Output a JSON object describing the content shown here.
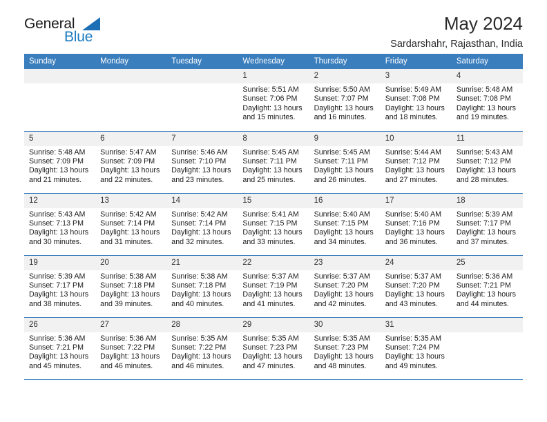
{
  "brand": {
    "word_one": "General",
    "word_two": "Blue",
    "triangle_icon": "triangle-icon",
    "colors": {
      "blue": "#1c7ac0",
      "dark": "#1a1a1a"
    }
  },
  "header": {
    "title": "May 2024",
    "subtitle": "Sardarshahr, Rajasthan, India"
  },
  "theme": {
    "header_bg": "#3a7ebe",
    "daynum_bg": "#f1f1f1",
    "row_rule": "#3a7ebe"
  },
  "weekdays": [
    "Sunday",
    "Monday",
    "Tuesday",
    "Wednesday",
    "Thursday",
    "Friday",
    "Saturday"
  ],
  "weeks": [
    [
      {
        "day": "",
        "sunrise": "",
        "sunset": "",
        "daylight_1": "",
        "daylight_2": ""
      },
      {
        "day": "",
        "sunrise": "",
        "sunset": "",
        "daylight_1": "",
        "daylight_2": ""
      },
      {
        "day": "",
        "sunrise": "",
        "sunset": "",
        "daylight_1": "",
        "daylight_2": ""
      },
      {
        "day": "1",
        "sunrise": "Sunrise: 5:51 AM",
        "sunset": "Sunset: 7:06 PM",
        "daylight_1": "Daylight: 13 hours",
        "daylight_2": "and 15 minutes."
      },
      {
        "day": "2",
        "sunrise": "Sunrise: 5:50 AM",
        "sunset": "Sunset: 7:07 PM",
        "daylight_1": "Daylight: 13 hours",
        "daylight_2": "and 16 minutes."
      },
      {
        "day": "3",
        "sunrise": "Sunrise: 5:49 AM",
        "sunset": "Sunset: 7:08 PM",
        "daylight_1": "Daylight: 13 hours",
        "daylight_2": "and 18 minutes."
      },
      {
        "day": "4",
        "sunrise": "Sunrise: 5:48 AM",
        "sunset": "Sunset: 7:08 PM",
        "daylight_1": "Daylight: 13 hours",
        "daylight_2": "and 19 minutes."
      }
    ],
    [
      {
        "day": "5",
        "sunrise": "Sunrise: 5:48 AM",
        "sunset": "Sunset: 7:09 PM",
        "daylight_1": "Daylight: 13 hours",
        "daylight_2": "and 21 minutes."
      },
      {
        "day": "6",
        "sunrise": "Sunrise: 5:47 AM",
        "sunset": "Sunset: 7:09 PM",
        "daylight_1": "Daylight: 13 hours",
        "daylight_2": "and 22 minutes."
      },
      {
        "day": "7",
        "sunrise": "Sunrise: 5:46 AM",
        "sunset": "Sunset: 7:10 PM",
        "daylight_1": "Daylight: 13 hours",
        "daylight_2": "and 23 minutes."
      },
      {
        "day": "8",
        "sunrise": "Sunrise: 5:45 AM",
        "sunset": "Sunset: 7:11 PM",
        "daylight_1": "Daylight: 13 hours",
        "daylight_2": "and 25 minutes."
      },
      {
        "day": "9",
        "sunrise": "Sunrise: 5:45 AM",
        "sunset": "Sunset: 7:11 PM",
        "daylight_1": "Daylight: 13 hours",
        "daylight_2": "and 26 minutes."
      },
      {
        "day": "10",
        "sunrise": "Sunrise: 5:44 AM",
        "sunset": "Sunset: 7:12 PM",
        "daylight_1": "Daylight: 13 hours",
        "daylight_2": "and 27 minutes."
      },
      {
        "day": "11",
        "sunrise": "Sunrise: 5:43 AM",
        "sunset": "Sunset: 7:12 PM",
        "daylight_1": "Daylight: 13 hours",
        "daylight_2": "and 28 minutes."
      }
    ],
    [
      {
        "day": "12",
        "sunrise": "Sunrise: 5:43 AM",
        "sunset": "Sunset: 7:13 PM",
        "daylight_1": "Daylight: 13 hours",
        "daylight_2": "and 30 minutes."
      },
      {
        "day": "13",
        "sunrise": "Sunrise: 5:42 AM",
        "sunset": "Sunset: 7:14 PM",
        "daylight_1": "Daylight: 13 hours",
        "daylight_2": "and 31 minutes."
      },
      {
        "day": "14",
        "sunrise": "Sunrise: 5:42 AM",
        "sunset": "Sunset: 7:14 PM",
        "daylight_1": "Daylight: 13 hours",
        "daylight_2": "and 32 minutes."
      },
      {
        "day": "15",
        "sunrise": "Sunrise: 5:41 AM",
        "sunset": "Sunset: 7:15 PM",
        "daylight_1": "Daylight: 13 hours",
        "daylight_2": "and 33 minutes."
      },
      {
        "day": "16",
        "sunrise": "Sunrise: 5:40 AM",
        "sunset": "Sunset: 7:15 PM",
        "daylight_1": "Daylight: 13 hours",
        "daylight_2": "and 34 minutes."
      },
      {
        "day": "17",
        "sunrise": "Sunrise: 5:40 AM",
        "sunset": "Sunset: 7:16 PM",
        "daylight_1": "Daylight: 13 hours",
        "daylight_2": "and 36 minutes."
      },
      {
        "day": "18",
        "sunrise": "Sunrise: 5:39 AM",
        "sunset": "Sunset: 7:17 PM",
        "daylight_1": "Daylight: 13 hours",
        "daylight_2": "and 37 minutes."
      }
    ],
    [
      {
        "day": "19",
        "sunrise": "Sunrise: 5:39 AM",
        "sunset": "Sunset: 7:17 PM",
        "daylight_1": "Daylight: 13 hours",
        "daylight_2": "and 38 minutes."
      },
      {
        "day": "20",
        "sunrise": "Sunrise: 5:38 AM",
        "sunset": "Sunset: 7:18 PM",
        "daylight_1": "Daylight: 13 hours",
        "daylight_2": "and 39 minutes."
      },
      {
        "day": "21",
        "sunrise": "Sunrise: 5:38 AM",
        "sunset": "Sunset: 7:18 PM",
        "daylight_1": "Daylight: 13 hours",
        "daylight_2": "and 40 minutes."
      },
      {
        "day": "22",
        "sunrise": "Sunrise: 5:37 AM",
        "sunset": "Sunset: 7:19 PM",
        "daylight_1": "Daylight: 13 hours",
        "daylight_2": "and 41 minutes."
      },
      {
        "day": "23",
        "sunrise": "Sunrise: 5:37 AM",
        "sunset": "Sunset: 7:20 PM",
        "daylight_1": "Daylight: 13 hours",
        "daylight_2": "and 42 minutes."
      },
      {
        "day": "24",
        "sunrise": "Sunrise: 5:37 AM",
        "sunset": "Sunset: 7:20 PM",
        "daylight_1": "Daylight: 13 hours",
        "daylight_2": "and 43 minutes."
      },
      {
        "day": "25",
        "sunrise": "Sunrise: 5:36 AM",
        "sunset": "Sunset: 7:21 PM",
        "daylight_1": "Daylight: 13 hours",
        "daylight_2": "and 44 minutes."
      }
    ],
    [
      {
        "day": "26",
        "sunrise": "Sunrise: 5:36 AM",
        "sunset": "Sunset: 7:21 PM",
        "daylight_1": "Daylight: 13 hours",
        "daylight_2": "and 45 minutes."
      },
      {
        "day": "27",
        "sunrise": "Sunrise: 5:36 AM",
        "sunset": "Sunset: 7:22 PM",
        "daylight_1": "Daylight: 13 hours",
        "daylight_2": "and 46 minutes."
      },
      {
        "day": "28",
        "sunrise": "Sunrise: 5:35 AM",
        "sunset": "Sunset: 7:22 PM",
        "daylight_1": "Daylight: 13 hours",
        "daylight_2": "and 46 minutes."
      },
      {
        "day": "29",
        "sunrise": "Sunrise: 5:35 AM",
        "sunset": "Sunset: 7:23 PM",
        "daylight_1": "Daylight: 13 hours",
        "daylight_2": "and 47 minutes."
      },
      {
        "day": "30",
        "sunrise": "Sunrise: 5:35 AM",
        "sunset": "Sunset: 7:23 PM",
        "daylight_1": "Daylight: 13 hours",
        "daylight_2": "and 48 minutes."
      },
      {
        "day": "31",
        "sunrise": "Sunrise: 5:35 AM",
        "sunset": "Sunset: 7:24 PM",
        "daylight_1": "Daylight: 13 hours",
        "daylight_2": "and 49 minutes."
      },
      {
        "day": "",
        "sunrise": "",
        "sunset": "",
        "daylight_1": "",
        "daylight_2": ""
      }
    ]
  ]
}
